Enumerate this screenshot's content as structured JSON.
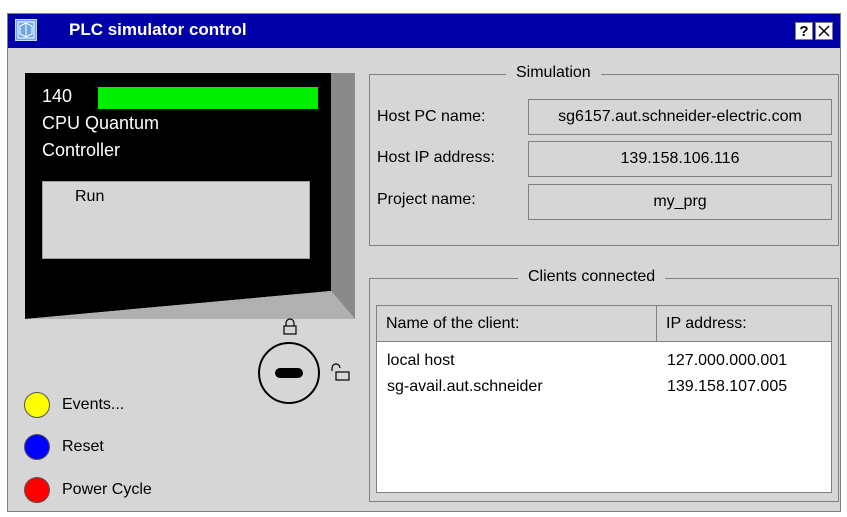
{
  "window": {
    "title": "PLC simulator control",
    "icon": "app-icon",
    "help_label": "?",
    "close_icon": "close-icon"
  },
  "plc": {
    "model": "140",
    "line2": "CPU Quantum",
    "line3": "Controller",
    "status": "Run",
    "led_color": "#00ee00"
  },
  "controls": {
    "events": {
      "label": "Events...",
      "color": "#ffff00"
    },
    "reset": {
      "label": "Reset",
      "color": "#0000ff"
    },
    "power_cycle": {
      "label": "Power Cycle",
      "color": "#ff0000"
    }
  },
  "simulation": {
    "title": "Simulation",
    "host_pc_label": "Host PC name:",
    "host_pc_value": "sg6157.aut.schneider-electric.com",
    "host_ip_label": "Host IP address:",
    "host_ip_value": "139.158.106.116",
    "project_label": "Project name:",
    "project_value": "my_prg"
  },
  "clients": {
    "title": "Clients connected",
    "headers": [
      "Name of the client:",
      "IP address:"
    ],
    "rows": [
      {
        "name": "local host",
        "ip": "127.000.000.001"
      },
      {
        "name": "sg-avail.aut.schneider",
        "ip": "139.158.107.005"
      }
    ]
  }
}
